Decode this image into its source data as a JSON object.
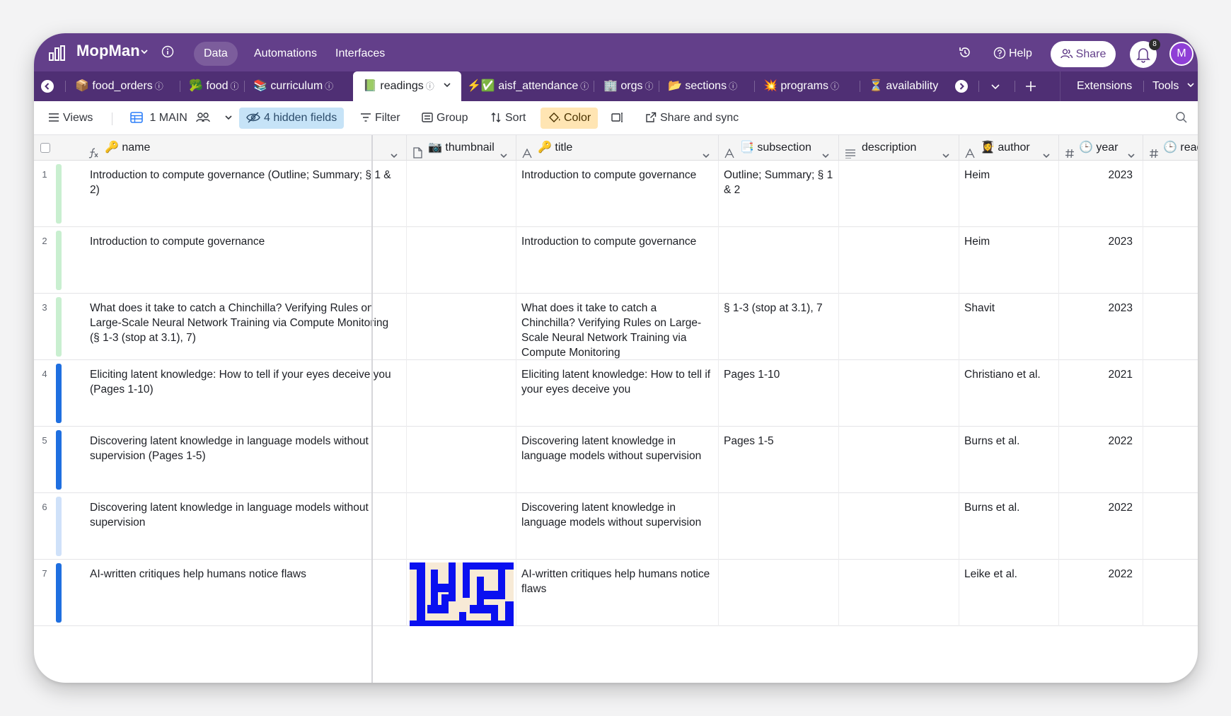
{
  "app": {
    "name": "MopMan",
    "nav": [
      "Data",
      "Automations",
      "Interfaces"
    ],
    "active_nav": "Data",
    "help_label": "Help",
    "share_label": "Share",
    "notification_count": "8",
    "avatar_initial": "M"
  },
  "colors": {
    "header": "#633f8a",
    "tabbar": "#4f2f74",
    "hidden_fields_bg": "#c6e3f7",
    "color_btn_bg": "#ffe5b3",
    "bar_green": "#c9efd0",
    "bar_blue": "#1f6fe0",
    "bar_light_blue": "#cfe1f9"
  },
  "tables": [
    {
      "emoji": "📦",
      "label": "food_orders"
    },
    {
      "emoji": "🥦",
      "label": "food"
    },
    {
      "emoji": "📚",
      "label": "curriculum"
    },
    {
      "emoji": "📗",
      "label": "readings"
    },
    {
      "emoji": "⚡✅",
      "label": "aisf_attendance"
    },
    {
      "emoji": "🏢",
      "label": "orgs"
    },
    {
      "emoji": "📂",
      "label": "sections"
    },
    {
      "emoji": "💥",
      "label": "programs"
    },
    {
      "emoji": "⏳",
      "label": "availability"
    }
  ],
  "active_table": "readings",
  "tabbar_right": {
    "extensions": "Extensions",
    "tools": "Tools"
  },
  "toolbar": {
    "views": "Views",
    "view_name": "1 MAIN",
    "hidden_fields": "4 hidden fields",
    "filter": "Filter",
    "group": "Group",
    "sort": "Sort",
    "color": "Color",
    "share_sync": "Share and sync"
  },
  "columns": [
    {
      "label": "name",
      "icon": "formula-icon",
      "emoji": "🔑"
    },
    {
      "label": "thumbnail",
      "icon": "attachment-icon",
      "emoji": "📷"
    },
    {
      "label": "title",
      "icon": "text-icon",
      "emoji": "🔑"
    },
    {
      "label": "subsection",
      "icon": "text-icon",
      "emoji": "📑"
    },
    {
      "label": "description",
      "icon": "long-text-icon",
      "emoji": ""
    },
    {
      "label": "author",
      "icon": "text-icon",
      "emoji": "👩‍🎓"
    },
    {
      "label": "year",
      "icon": "number-icon",
      "emoji": "🕒"
    },
    {
      "label": "read_time",
      "icon": "number-icon",
      "emoji": "🕒"
    }
  ],
  "rows": [
    {
      "num": "1",
      "color": "green",
      "name": "Introduction to compute governance (Outline; Summary; § 1 & 2)",
      "title": "Introduction to compute governance",
      "subsection": "Outline; Summary; § 1 & 2",
      "description": "",
      "author": "Heim",
      "year": "2023",
      "thumbnail": false
    },
    {
      "num": "2",
      "color": "green",
      "name": "Introduction to compute governance",
      "title": "Introduction to compute governance",
      "subsection": "",
      "description": "",
      "author": "Heim",
      "year": "2023",
      "thumbnail": false
    },
    {
      "num": "3",
      "color": "green",
      "name": "What does it take to catch a Chinchilla? Verifying Rules on Large-Scale Neural Network Training via Compute Monitoring (§ 1-3 (stop at 3.1), 7)",
      "title": "What does it take to catch a Chinchilla? Verifying Rules on Large-Scale Neural Network Training via Compute Monitoring",
      "subsection": "§ 1-3 (stop at 3.1), 7",
      "description": "",
      "author": "Shavit",
      "year": "2023",
      "thumbnail": false
    },
    {
      "num": "4",
      "color": "blue",
      "name": "Eliciting latent knowledge: How to tell if your eyes deceive you (Pages 1-10)",
      "title": "Eliciting latent knowledge: How to tell if your eyes deceive you",
      "subsection": "Pages 1-10",
      "description": "",
      "author": "Christiano et al.",
      "year": "2021",
      "thumbnail": false
    },
    {
      "num": "5",
      "color": "blue",
      "name": "Discovering latent knowledge in language models without supervision (Pages 1-5)",
      "title": "Discovering latent knowledge in language models without supervision",
      "subsection": "Pages 1-5",
      "description": "",
      "author": "Burns et al.",
      "year": "2022",
      "thumbnail": false
    },
    {
      "num": "6",
      "color": "lightblue",
      "name": "Discovering latent knowledge in language models without supervision",
      "title": "Discovering latent knowledge in language models without supervision",
      "subsection": "",
      "description": "",
      "author": "Burns et al.",
      "year": "2022",
      "thumbnail": false
    },
    {
      "num": "7",
      "color": "blue",
      "name": "AI-written critiques help humans notice flaws",
      "title": "AI-written critiques help humans notice flaws",
      "subsection": "",
      "description": "",
      "author": "Leike et al.",
      "year": "2022",
      "thumbnail": true
    }
  ]
}
